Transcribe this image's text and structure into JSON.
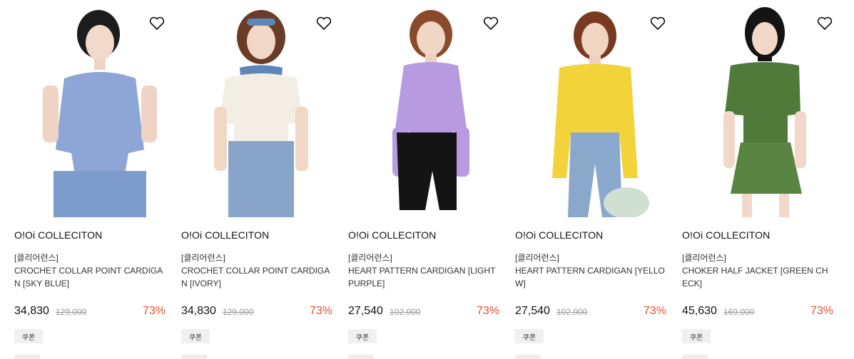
{
  "products": [
    {
      "brand": "O!Oi COLLECITON",
      "tag": "[클리어런스]",
      "title": "CROCHET COLLAR POINT CARDIGAN [SKY BLUE]",
      "price": "34,830",
      "original_price": "129,000",
      "discount": "73%",
      "coupon": "쿠폰",
      "top_color": "#8ea6d6",
      "bottom_color": "#7d9ccc"
    },
    {
      "brand": "O!Oi COLLECITON",
      "tag": "[클리어런스]",
      "title": "CROCHET COLLAR POINT CARDIGAN [IVORY]",
      "price": "34,830",
      "original_price": "129,000",
      "discount": "73%",
      "coupon": "쿠폰",
      "top_color": "#f2eee4",
      "bottom_color": "#88a5c9"
    },
    {
      "brand": "O!Oi COLLECITON",
      "tag": "[클리어런스]",
      "title": "HEART PATTERN CARDIGAN [LIGHT PURPLE]",
      "price": "27,540",
      "original_price": "102,000",
      "discount": "73%",
      "coupon": "쿠폰",
      "top_color": "#b79ae0",
      "bottom_color": "#141414"
    },
    {
      "brand": "O!Oi COLLECITON",
      "tag": "[클리어런스]",
      "title": "HEART PATTERN CARDIGAN [YELLOW]",
      "price": "27,540",
      "original_price": "102,000",
      "discount": "73%",
      "coupon": "쿠폰",
      "top_color": "#f2d43a",
      "bottom_color": "#8aa7cc"
    },
    {
      "brand": "O!Oi COLLECITON",
      "tag": "[클리어런스]",
      "title": "CHOKER HALF JACKET [GREEN CHECK]",
      "price": "45,630",
      "original_price": "169,000",
      "discount": "73%",
      "coupon": "쿠폰",
      "top_color": "#4f7a3a",
      "bottom_color": "#5a8442"
    }
  ]
}
